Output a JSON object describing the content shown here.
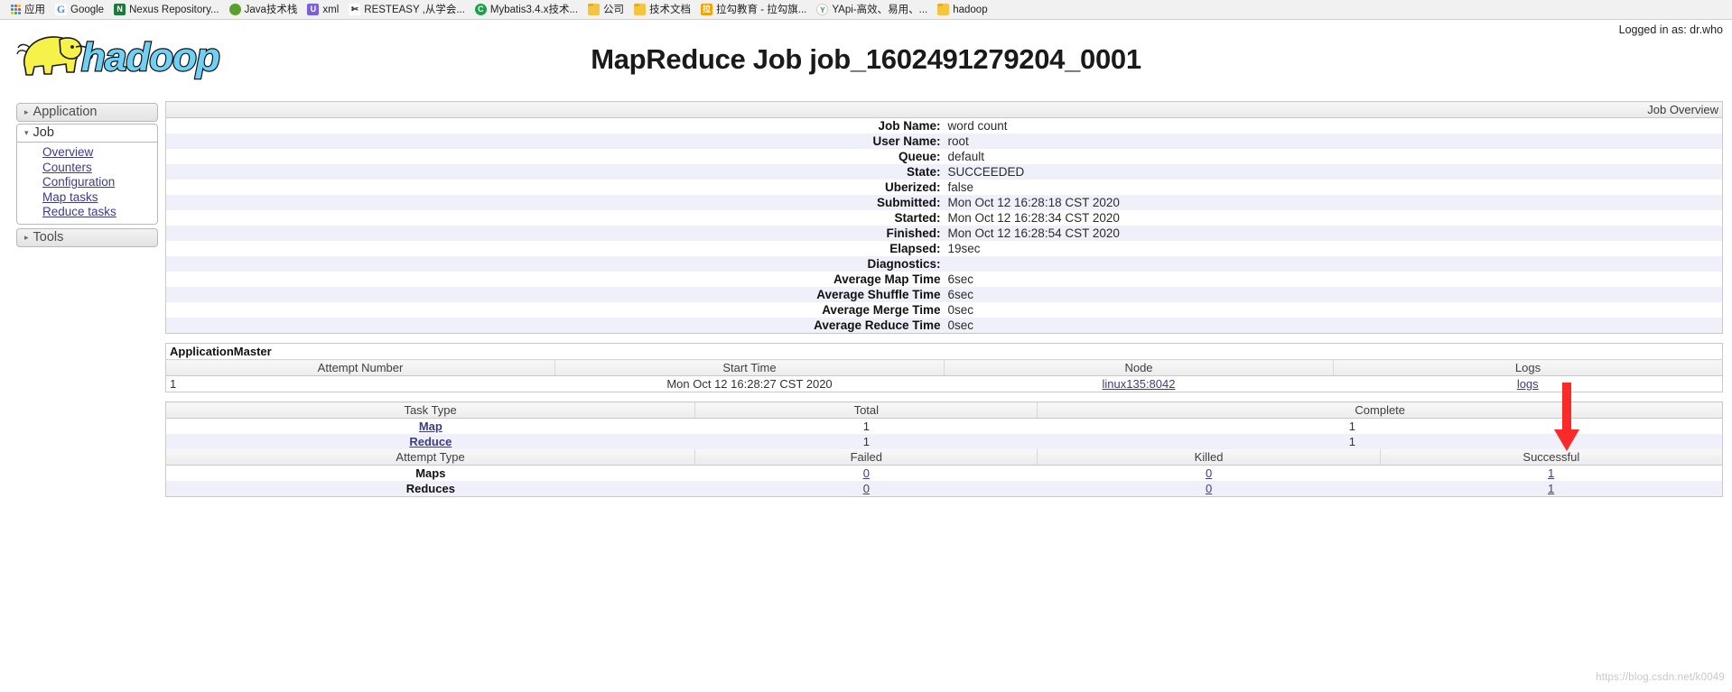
{
  "browser": {
    "bookmarks": [
      {
        "label": "应用",
        "icon": "apps-grid-icon",
        "icon_class": "ico-apps",
        "icon_text": ""
      },
      {
        "label": "Google",
        "icon": "google-icon",
        "icon_class": "ico-google",
        "icon_text": "G"
      },
      {
        "label": "Nexus Repository...",
        "icon": "nexus-icon",
        "icon_class": "ico-nexus",
        "icon_text": "N"
      },
      {
        "label": "Java技术栈",
        "icon": "java-icon",
        "icon_class": "ico-java",
        "icon_text": ""
      },
      {
        "label": "xml",
        "icon": "xml-icon",
        "icon_class": "ico-xml",
        "icon_text": "U"
      },
      {
        "label": "RESTEASY ,从学会...",
        "icon": "resteasy-icon",
        "icon_class": "ico-rest",
        "icon_text": "✄"
      },
      {
        "label": "Mybatis3.4.x技术...",
        "icon": "mybatis-icon",
        "icon_class": "ico-myb",
        "icon_text": "C"
      },
      {
        "label": "公司",
        "icon": "folder-icon",
        "icon_class": "ico-folder",
        "icon_text": ""
      },
      {
        "label": "技术文档",
        "icon": "folder-icon",
        "icon_class": "ico-folder",
        "icon_text": ""
      },
      {
        "label": "拉勾教育 - 拉勾旗...",
        "icon": "lagou-icon",
        "icon_class": "ico-lagou",
        "icon_text": "拉"
      },
      {
        "label": "YApi-高效、易用、...",
        "icon": "yapi-icon",
        "icon_class": "ico-yapi",
        "icon_text": "Y"
      },
      {
        "label": "hadoop",
        "icon": "folder-icon",
        "icon_class": "ico-folder",
        "icon_text": ""
      }
    ]
  },
  "header": {
    "logo_text": "hadoop",
    "title": "MapReduce Job job_1602491279204_0001",
    "login_status": "Logged in as: dr.who"
  },
  "sidebar": {
    "sections": [
      {
        "label": "Application",
        "expanded": false,
        "arrow": "▸",
        "links": []
      },
      {
        "label": "Job",
        "expanded": true,
        "arrow": "▾",
        "links": [
          "Overview",
          "Counters",
          "Configuration",
          "Map tasks",
          "Reduce tasks"
        ]
      },
      {
        "label": "Tools",
        "expanded": false,
        "arrow": "▸",
        "links": []
      }
    ]
  },
  "job_overview": {
    "caption": "Job Overview",
    "rows": [
      {
        "key": "Job Name:",
        "value": "word count"
      },
      {
        "key": "User Name:",
        "value": "root"
      },
      {
        "key": "Queue:",
        "value": "default"
      },
      {
        "key": "State:",
        "value": "SUCCEEDED"
      },
      {
        "key": "Uberized:",
        "value": "false"
      },
      {
        "key": "Submitted:",
        "value": "Mon Oct 12 16:28:18 CST 2020"
      },
      {
        "key": "Started:",
        "value": "Mon Oct 12 16:28:34 CST 2020"
      },
      {
        "key": "Finished:",
        "value": "Mon Oct 12 16:28:54 CST 2020"
      },
      {
        "key": "Elapsed:",
        "value": "19sec"
      },
      {
        "key": "Diagnostics:",
        "value": ""
      },
      {
        "key": "Average Map Time",
        "value": "6sec"
      },
      {
        "key": "Average Shuffle Time",
        "value": "6sec"
      },
      {
        "key": "Average Merge Time",
        "value": "0sec"
      },
      {
        "key": "Average Reduce Time",
        "value": "0sec"
      }
    ]
  },
  "application_master": {
    "title": "ApplicationMaster",
    "columns": [
      "Attempt Number",
      "Start Time",
      "Node",
      "Logs"
    ],
    "rows": [
      {
        "attempt": "1",
        "start_time": "Mon Oct 12 16:28:27 CST 2020",
        "node": "linux135:8042",
        "logs": "logs"
      }
    ]
  },
  "tasks_table": {
    "columns": [
      "Task Type",
      "Total",
      "Complete"
    ],
    "rows": [
      {
        "task_type": "Map",
        "total": "1",
        "complete": "1"
      },
      {
        "task_type": "Reduce",
        "total": "1",
        "complete": "1"
      }
    ]
  },
  "attempts_table": {
    "columns": [
      "Attempt Type",
      "Failed",
      "Killed",
      "Successful"
    ],
    "rows": [
      {
        "attempt_type": "Maps",
        "failed": "0",
        "killed": "0",
        "successful": "1"
      },
      {
        "attempt_type": "Reduces",
        "failed": "0",
        "killed": "0",
        "successful": "1"
      }
    ]
  },
  "annotations": {
    "arrow_color": "#fb2a2a",
    "arrow_target": "logs"
  },
  "watermark": "https://blog.csdn.net/k0049"
}
